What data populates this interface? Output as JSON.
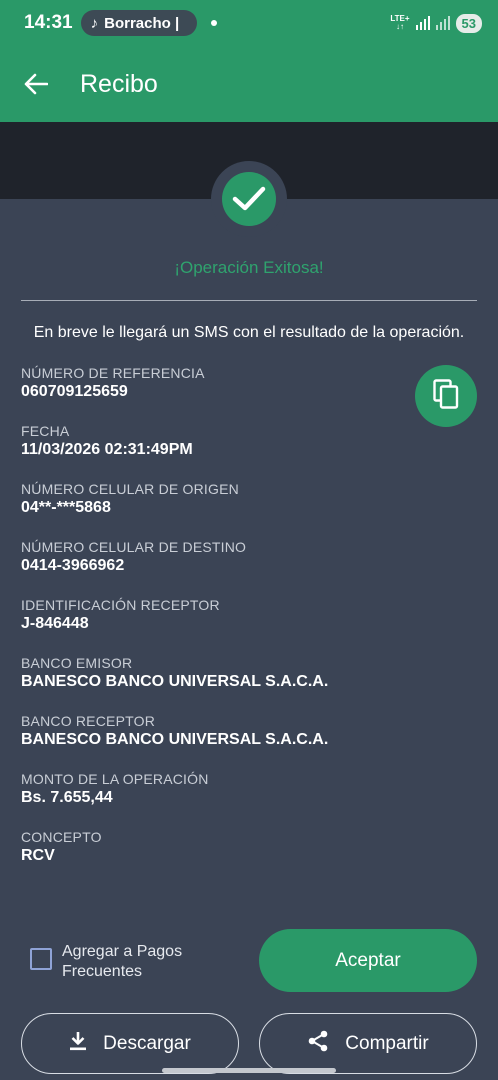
{
  "status_bar": {
    "time": "14:31",
    "media_text": "Borracho |",
    "network": "LTE+",
    "battery": "53"
  },
  "app_bar": {
    "title": "Recibo",
    "back_icon": "arrow-left-icon"
  },
  "receipt": {
    "success_message": "¡Operación Exitosa!",
    "sms_message": "En breve le llegará un SMS con el resultado de la operación.",
    "fields": [
      {
        "label": "NÚMERO DE REFERENCIA",
        "value": "060709125659"
      },
      {
        "label": "FECHA",
        "value": "11/03/2026 02:31:49PM"
      },
      {
        "label": "NÚMERO CELULAR DE ORIGEN",
        "value": "04**-***5868"
      },
      {
        "label": "NÚMERO CELULAR DE DESTINO",
        "value": "0414-3966962"
      },
      {
        "label": "IDENTIFICACIÓN RECEPTOR",
        "value": "J-846448"
      },
      {
        "label": "BANCO EMISOR",
        "value": "BANESCO BANCO UNIVERSAL S.A.C.A."
      },
      {
        "label": "BANCO RECEPTOR",
        "value": "BANESCO BANCO UNIVERSAL S.A.C.A."
      },
      {
        "label": "MONTO DE LA OPERACIÓN",
        "value": "Bs. 7.655,44"
      },
      {
        "label": "CONCEPTO",
        "value": "RCV"
      }
    ]
  },
  "actions": {
    "frequent_label": "Agregar a Pagos Frecuentes",
    "accept_label": "Aceptar",
    "download_label": "Descargar",
    "share_label": "Compartir"
  },
  "colors": {
    "brand_green": "#2a9968",
    "background": "#3b4455",
    "dark_band": "#1f232b"
  }
}
